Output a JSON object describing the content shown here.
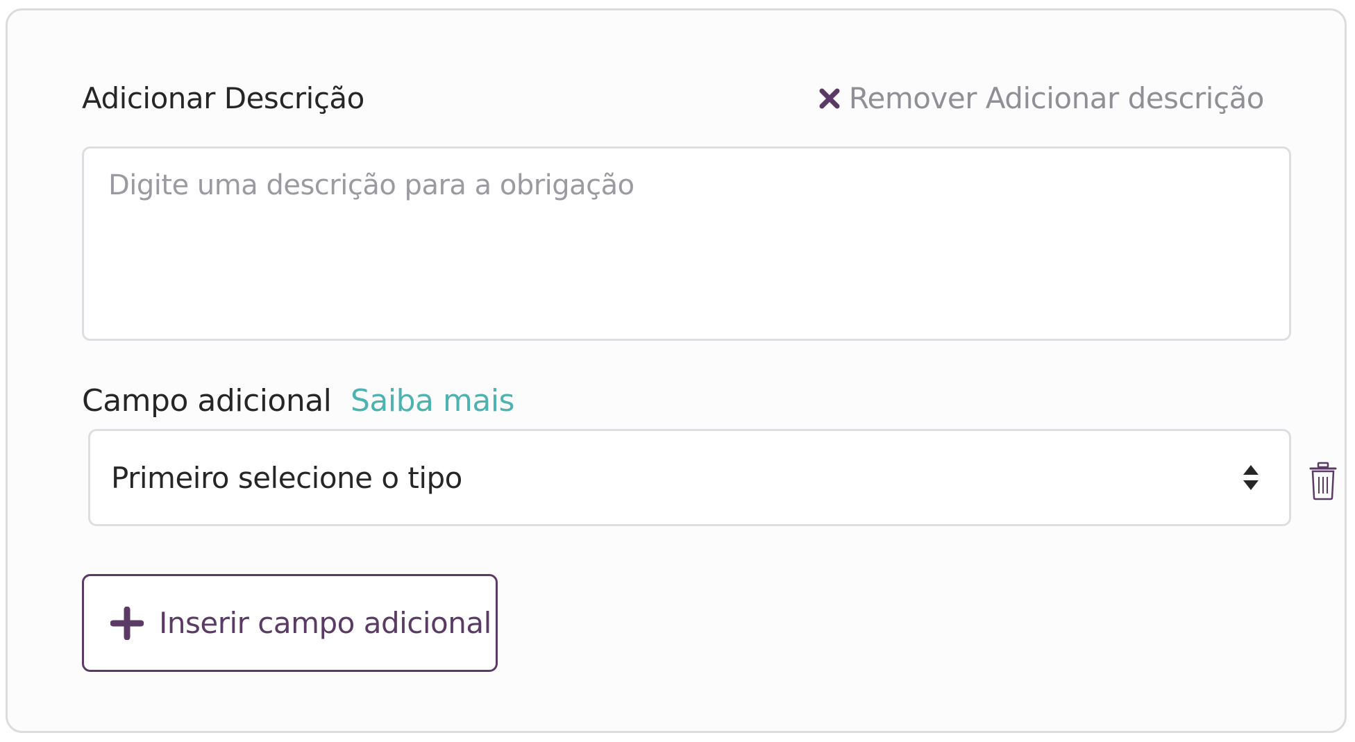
{
  "description_section": {
    "title": "Adicionar Descrição",
    "remove_label": "Remover Adicionar descrição",
    "remove_icon": "close-x-icon",
    "placeholder": "Digite uma descrição para a obrigação",
    "value": ""
  },
  "additional_field": {
    "label": "Campo adicional",
    "help_link": "Saiba mais",
    "select_value": "Primeiro selecione o tipo",
    "select_icon": "sort-updown-icon",
    "delete_icon": "trash-icon"
  },
  "add_button": {
    "label": "Inserir campo adicional",
    "icon": "plus-icon"
  },
  "colors": {
    "accent": "#5b3a66",
    "link": "#4db3b0",
    "muted_text": "#8f8f96",
    "border": "#dedee2"
  }
}
